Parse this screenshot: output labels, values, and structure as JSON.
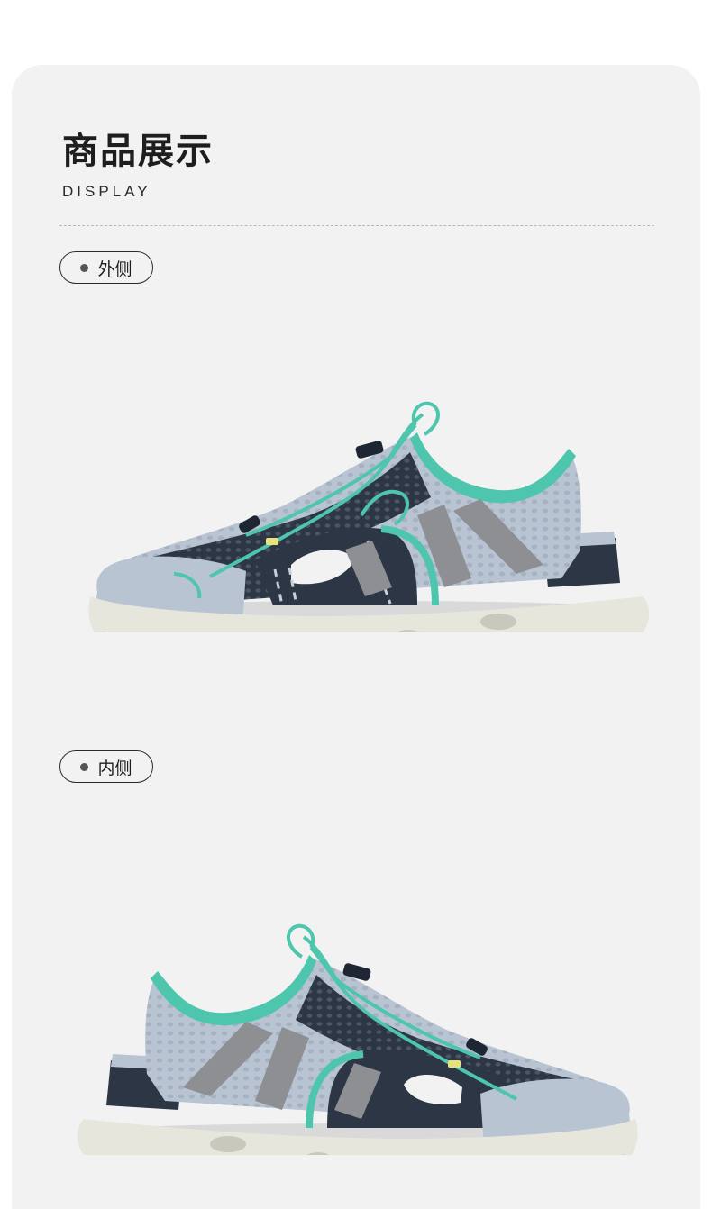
{
  "section": {
    "title": "商品展示",
    "subtitle": "DISPLAY"
  },
  "views": [
    {
      "label": "外侧",
      "image": "shoe-outer-side"
    },
    {
      "label": "内侧",
      "image": "shoe-inner-side"
    }
  ],
  "colors": {
    "background": "#f2f2f2",
    "mesh_light": "#b9c4d3",
    "navy": "#2c3645",
    "teal": "#4dc6ad",
    "sole": "#e7e6dc",
    "strap": "#8d8f93"
  }
}
